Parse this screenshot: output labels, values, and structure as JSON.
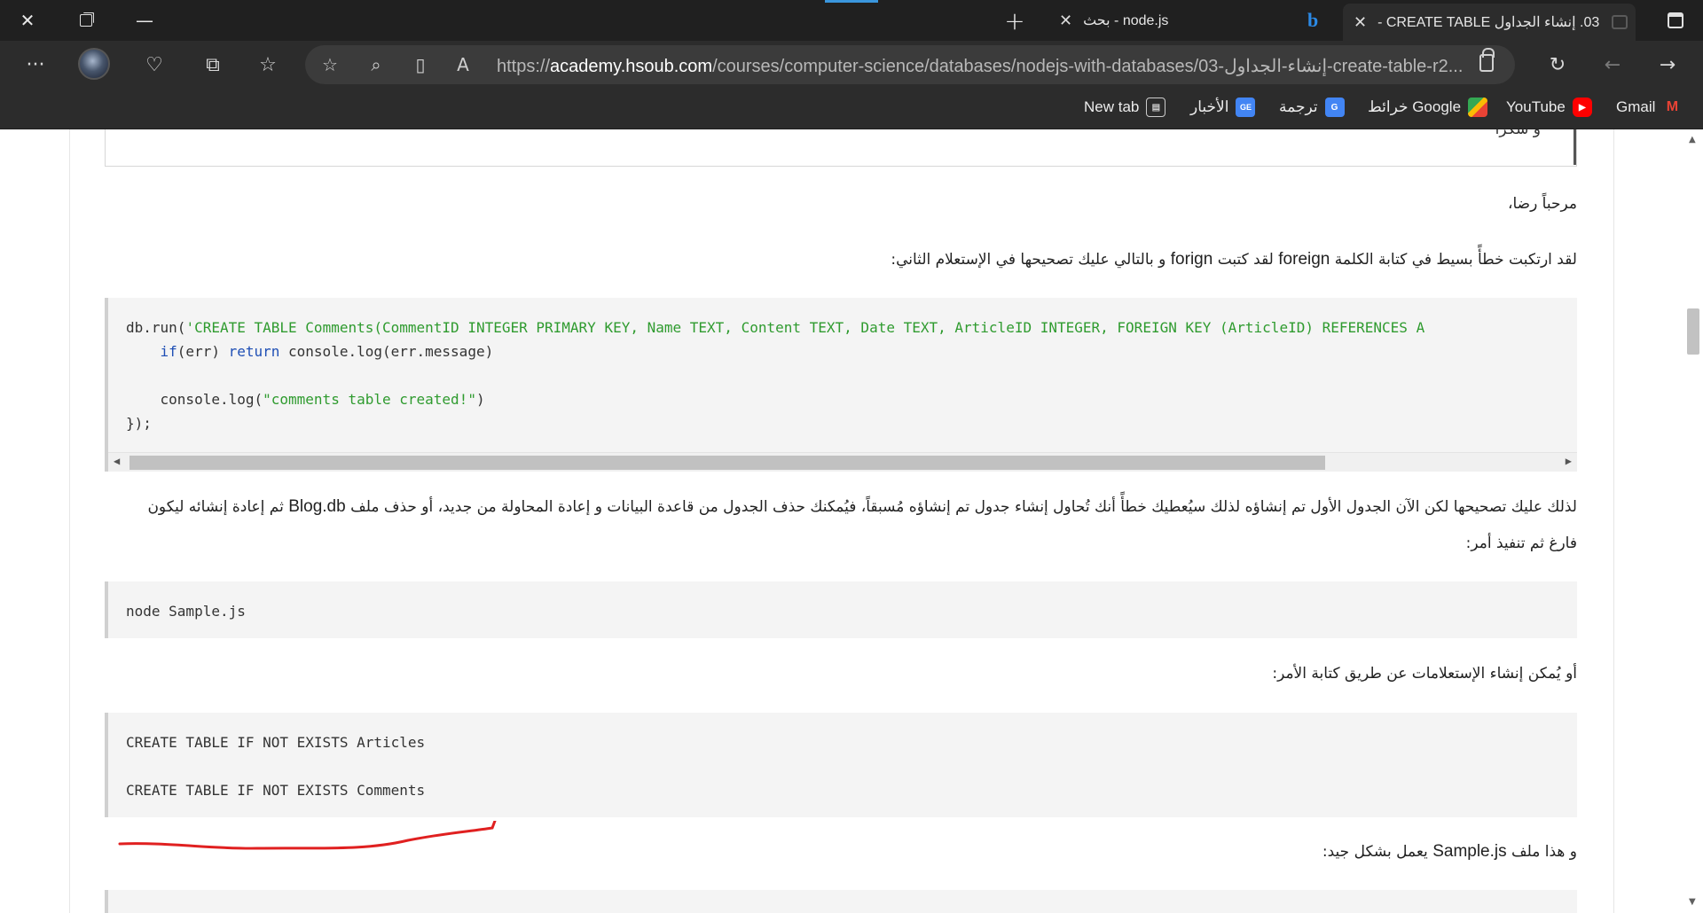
{
  "window": {
    "tabs": [
      {
        "title": "03. إنشاء الجداول CREATE TABLE -",
        "active": true
      },
      {
        "title": "node.js - بحث",
        "active": false
      }
    ]
  },
  "toolbar": {
    "url_prefix": "https://",
    "url_host": "academy.hsoub.com",
    "url_path": "/courses/computer-science/databases/nodejs-with-databases/03-إنشاء-الجداول-create-table-r2..."
  },
  "bookmarks": [
    {
      "label": "Gmail",
      "icon": "gmail-icon",
      "color": "#ea4335"
    },
    {
      "label": "YouTube",
      "icon": "youtube-icon",
      "color": "#ff0000"
    },
    {
      "label": "خرائط Google",
      "icon": "maps-icon",
      "color": "#34a853"
    },
    {
      "label": "ترجمة",
      "icon": "translate-icon",
      "color": "#4285f4"
    },
    {
      "label": "الأخبار",
      "icon": "news-icon",
      "color": "#4285f4"
    },
    {
      "label": "New tab",
      "icon": "newtab-icon",
      "color": "#cccccc"
    }
  ],
  "content": {
    "prev_text": "و شكرا",
    "greeting": "مرحباً رضا،",
    "para1_a": "لقد ارتكبت خطأً بسيط في كتابة الكلمة",
    "para1_word1": "foreign",
    "para1_b": "لقد كتبت",
    "para1_word2": "forign",
    "para1_c": "و بالتالي عليك تصحيحها في الإستعلام الثاني:",
    "code1": {
      "l1_fn": "db.run(",
      "l1_str": "'CREATE TABLE Comments(CommentID INTEGER PRIMARY KEY, Name TEXT, Content TEXT, Date TEXT, ArticleID INTEGER, FOREIGN KEY (ArticleID) REFERENCES A",
      "l2_kw1": "if",
      "l2_mid": "(err) ",
      "l2_kw2": "return",
      "l2_rest": " console.log(err.message)",
      "l4_fn": "console.log(",
      "l4_str": "\"comments table created!\"",
      "l4_end": ")",
      "l5": "});"
    },
    "para2_a": "لذلك عليك تصحيحها لكن الآن الجدول الأول تم إنشاؤه لذلك سيُعطيك خطأً أنك تُحاول إنشاء جدول تم إنشاؤه مُسبقاً، فيُمكنك حذف الجدول من قاعدة البيانات و إعادة المحاولة من جديد، أو حذف ملف",
    "para2_file": "Blog.db",
    "para2_b": "ثم إعادة إنشائه ليكون",
    "para2_line2": "فارغ ثم تنفيذ أمر:",
    "code2": "node Sample.js",
    "para3": "أو يُمكن إنشاء الإستعلامات عن طريق كتابة الأمر:",
    "code3_l1": "CREATE TABLE IF NOT EXISTS Articles",
    "code3_l2": "CREATE TABLE IF NOT EXISTS Comments",
    "para4_a": "و هذا ملف",
    "para4_file": "Sample.js",
    "para4_b": "يعمل بشكل جيد:"
  },
  "colors": {
    "code_string": "#2f9b2f",
    "code_keyword": "#1f4fb5",
    "annotation": "#e02020"
  }
}
